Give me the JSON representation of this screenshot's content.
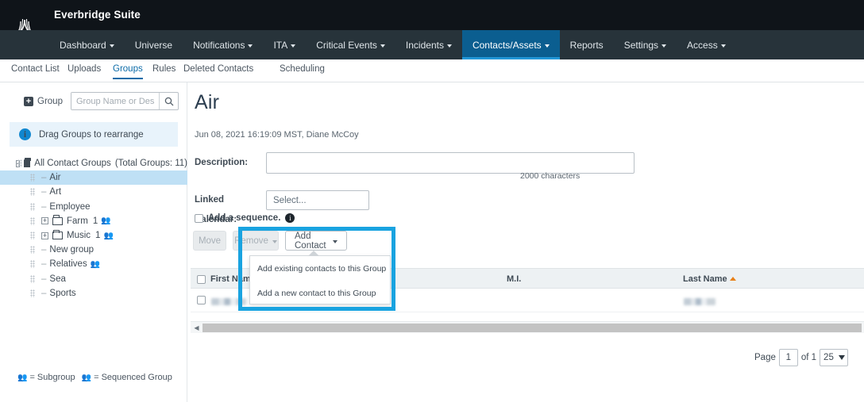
{
  "topbar": {
    "suite_title": "Everbridge Suite",
    "logo_icon": "everbridge-logo-icon"
  },
  "nav": {
    "items": [
      {
        "label": "Dashboard",
        "caret": true,
        "active": false
      },
      {
        "label": "Universe",
        "caret": false,
        "active": false
      },
      {
        "label": "Notifications",
        "caret": true,
        "active": false
      },
      {
        "label": "ITA",
        "caret": true,
        "active": false
      },
      {
        "label": "Critical Events",
        "caret": true,
        "active": false
      },
      {
        "label": "Incidents",
        "caret": true,
        "active": false
      },
      {
        "label": "Contacts/Assets",
        "caret": true,
        "active": true
      },
      {
        "label": "Reports",
        "caret": false,
        "active": false
      },
      {
        "label": "Settings",
        "caret": true,
        "active": false
      },
      {
        "label": "Access",
        "caret": true,
        "active": false
      }
    ]
  },
  "subtabs": {
    "items": [
      {
        "label": "Contact List",
        "active": false
      },
      {
        "label": "Uploads",
        "active": false
      },
      {
        "label": "Groups",
        "active": true
      },
      {
        "label": "Rules",
        "active": false
      },
      {
        "label": "Deleted Contacts",
        "active": false
      },
      {
        "label": "Scheduling",
        "active": false
      }
    ]
  },
  "sidebar": {
    "group_button_label": "Group",
    "search_placeholder": "Group Name or Descrip...",
    "search_value": "",
    "search_icon": "search-icon",
    "info_message": "Drag Groups to rearrange",
    "tree": [
      {
        "label": "All Contact Groups",
        "suffix": "(Total Groups: 11)",
        "toggle": "-",
        "icon": "folder-filled",
        "indent": 0,
        "selected": false,
        "count": "",
        "badge": ""
      },
      {
        "label": "Air",
        "suffix": "",
        "toggle": "",
        "icon": "dash",
        "indent": 1,
        "selected": true,
        "count": "",
        "badge": ""
      },
      {
        "label": "Art",
        "suffix": "",
        "toggle": "",
        "icon": "dash",
        "indent": 1,
        "selected": false,
        "count": "",
        "badge": ""
      },
      {
        "label": "Employee",
        "suffix": "",
        "toggle": "",
        "icon": "dash",
        "indent": 1,
        "selected": false,
        "count": "",
        "badge": ""
      },
      {
        "label": "Farm",
        "suffix": "",
        "toggle": "+",
        "icon": "folder",
        "indent": 1,
        "selected": false,
        "count": "1",
        "badge": "subgroup"
      },
      {
        "label": "Music",
        "suffix": "",
        "toggle": "+",
        "icon": "folder",
        "indent": 1,
        "selected": false,
        "count": "1",
        "badge": "subgroup"
      },
      {
        "label": "New group",
        "suffix": "",
        "toggle": "",
        "icon": "dash",
        "indent": 1,
        "selected": false,
        "count": "",
        "badge": ""
      },
      {
        "label": "Relatives",
        "suffix": "",
        "toggle": "",
        "icon": "dash",
        "indent": 1,
        "selected": false,
        "count": "",
        "badge": "sequenced"
      },
      {
        "label": "Sea",
        "suffix": "",
        "toggle": "",
        "icon": "dash",
        "indent": 1,
        "selected": false,
        "count": "",
        "badge": ""
      },
      {
        "label": "Sports",
        "suffix": "",
        "toggle": "",
        "icon": "dash",
        "indent": 1,
        "selected": false,
        "count": "",
        "badge": ""
      }
    ]
  },
  "main": {
    "title": "Air",
    "subtitle": "Jun 08, 2021 16:19:09 MST, Diane McCoy",
    "description_label": "Description:",
    "description_value": "",
    "char_count": "2000 characters",
    "linked_calendar_label": "Linked Calendar:",
    "linked_calendar_value": "Select...",
    "sequence_label": "Add a sequence.",
    "sequence_info_icon": "info-icon",
    "sequence_checked": false,
    "buttons": {
      "move": "Move",
      "remove": "Remove",
      "add_contact": "Add Contact"
    },
    "dropdown": {
      "items": [
        "Add existing contacts to this Group",
        "Add a new contact to this Group"
      ]
    },
    "table": {
      "columns": [
        "First Name",
        "M.I.",
        "Last Name"
      ],
      "sorted_column": "Last Name",
      "sort_direction": "asc",
      "rows": [
        {
          "first_name": "",
          "mi": "",
          "last_name": "",
          "redacted": true
        }
      ]
    },
    "pager": {
      "page_label": "Page",
      "page_value": "1",
      "of_label": "of 1",
      "page_size": "25"
    }
  },
  "legend": {
    "subgroup_icon": "subgroup-icon",
    "subgroup_label": "= Subgroup",
    "sequenced_icon": "sequenced-group-icon",
    "sequenced_label": "= Sequenced Group"
  },
  "colors": {
    "topbar": "#0f1419",
    "navbar": "#27333a",
    "active_tab": "#0b5e90",
    "accent": "#0b6ba8",
    "highlight": "#19a3e0",
    "selection": "#bfe0f5",
    "sort_caret": "#e8811a"
  }
}
